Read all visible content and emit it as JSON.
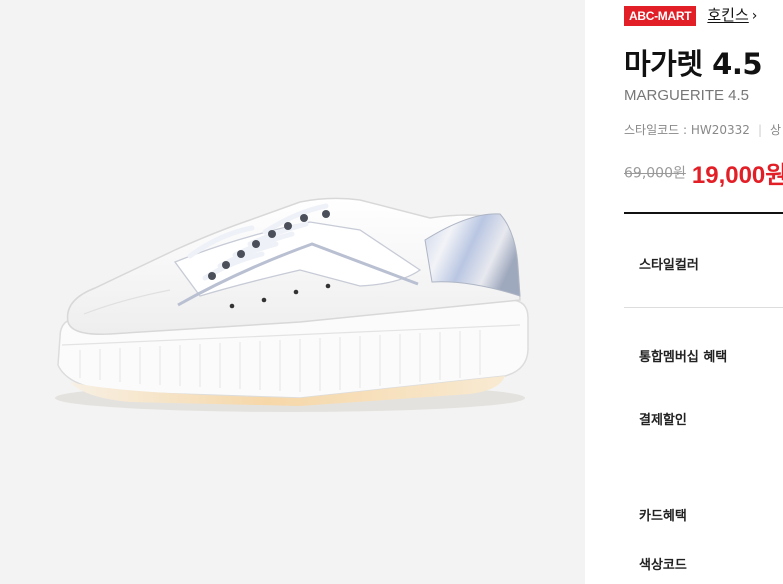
{
  "brand": {
    "badge": "ABC-MART",
    "name": "호킨스"
  },
  "product": {
    "title": "마가렛 4.5",
    "subtitle": "MARGUERITE 4.5",
    "style_code_label": "스타일코드 : HW20332",
    "style_code_more": "상",
    "price_original": "69,000원",
    "price_sale": "19,000원"
  },
  "options": {
    "style_color": "스타일컬러",
    "membership": "통합멤버십 혜택",
    "payment_discount": "결제할인",
    "card_benefit": "카드혜택",
    "color_code": "색상코드"
  },
  "icons": {
    "brand_link": "chevron-right-icon"
  },
  "colors": {
    "accent": "#e21e26",
    "gallery_bg": "#f3f3f3"
  }
}
